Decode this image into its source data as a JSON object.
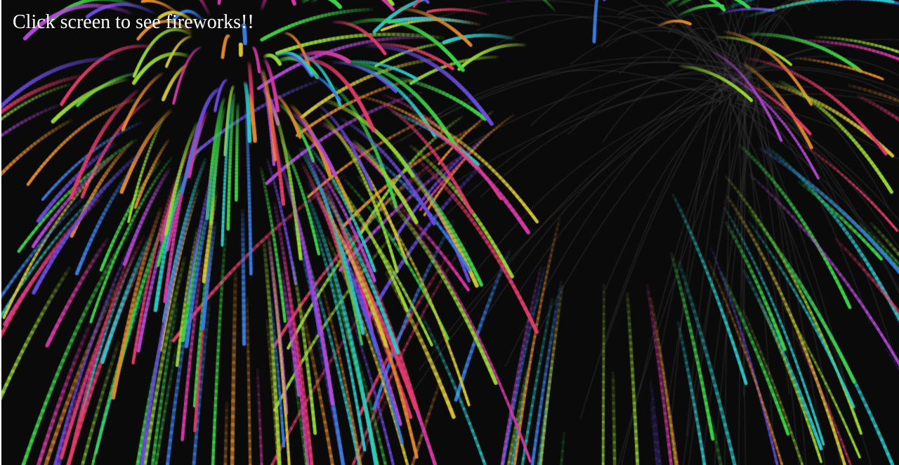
{
  "page": {
    "instruction": "Click screen to see fireworks!!"
  },
  "theme": {
    "background": "#0a0a0a",
    "text_color": "#ffffff",
    "spark_colors": [
      "#e23c6a",
      "#3fd24a",
      "#6a4ce0",
      "#d4c43a",
      "#2fc6c8",
      "#e08a2f",
      "#b34ad6",
      "#d63aa6",
      "#3a7de0",
      "#9ad63a"
    ]
  },
  "fireworks": {
    "visible_bursts": 2,
    "style": "falling-trail sparks"
  }
}
